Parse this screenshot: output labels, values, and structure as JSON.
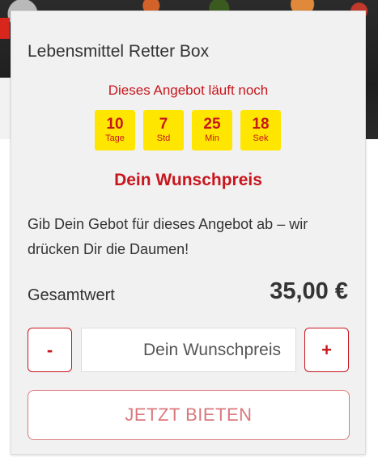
{
  "offer": {
    "title": "Lebensmittel Retter Box",
    "countdown_label": "Dieses Angebot läuft noch",
    "countdown": [
      {
        "value": "10",
        "unit": "Tage"
      },
      {
        "value": "7",
        "unit": "Std"
      },
      {
        "value": "25",
        "unit": "Min"
      },
      {
        "value": "18",
        "unit": "Sek"
      }
    ]
  },
  "bid": {
    "heading": "Dein Wunschpreis",
    "description": "Gib Dein Gebot für dieses Angebot ab – wir drücken Dir die Daumen!",
    "total_label": "Gesamtwert",
    "total_value": "35,00 €",
    "minus_label": "-",
    "plus_label": "+",
    "input_placeholder": "Dein Wunschpreis",
    "input_value": "",
    "submit_label": "JETZT BIETEN"
  },
  "colors": {
    "accent": "#c8161d",
    "countdown_bg": "#ffe600",
    "card_bg": "#f1f1f1"
  }
}
